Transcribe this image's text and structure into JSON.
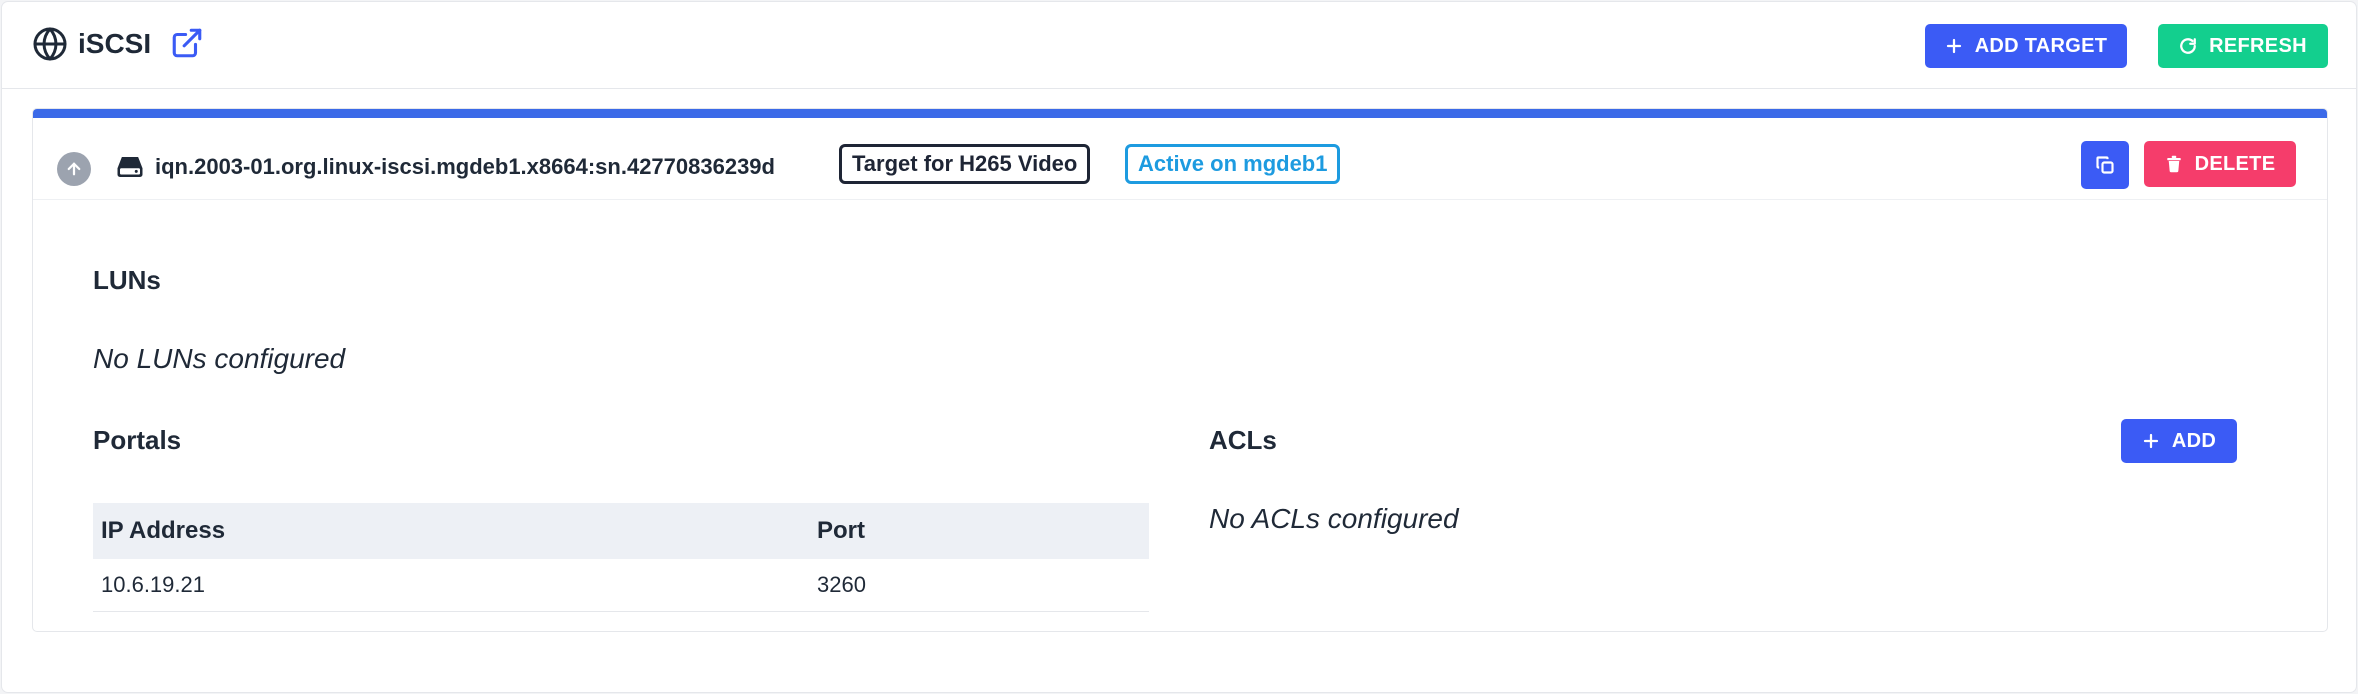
{
  "header": {
    "title": "iSCSI",
    "add_target_label": "ADD TARGET",
    "refresh_label": "REFRESH"
  },
  "target": {
    "iqn": "iqn.2003-01.org.linux-iscsi.mgdeb1.x8664:sn.42770836239d",
    "description": "Target for H265 Video",
    "status": "Active on mgdeb1",
    "delete_label": "DELETE"
  },
  "luns": {
    "title": "LUNs",
    "empty_text": "No LUNs configured"
  },
  "portals": {
    "title": "Portals",
    "columns": [
      "IP Address",
      "Port"
    ],
    "rows": [
      {
        "ip": "10.6.19.21",
        "port": "3260"
      }
    ]
  },
  "acls": {
    "title": "ACLs",
    "add_label": "ADD",
    "empty_text": "No ACLs configured"
  },
  "colors": {
    "primary": "#3b5bf5",
    "success": "#13cf8e",
    "danger": "#f53d6b",
    "active_tag": "#1d9be0",
    "card_accent": "#3b6ae8"
  },
  "icons": {
    "title": "globe-icon",
    "open": "external-link-icon",
    "add_target": "plus-icon",
    "refresh": "refresh-icon",
    "collapse": "arrow-up-icon",
    "target": "hard-drive-icon",
    "copy": "copy-icon",
    "delete": "trash-icon",
    "add_acl": "plus-icon"
  }
}
